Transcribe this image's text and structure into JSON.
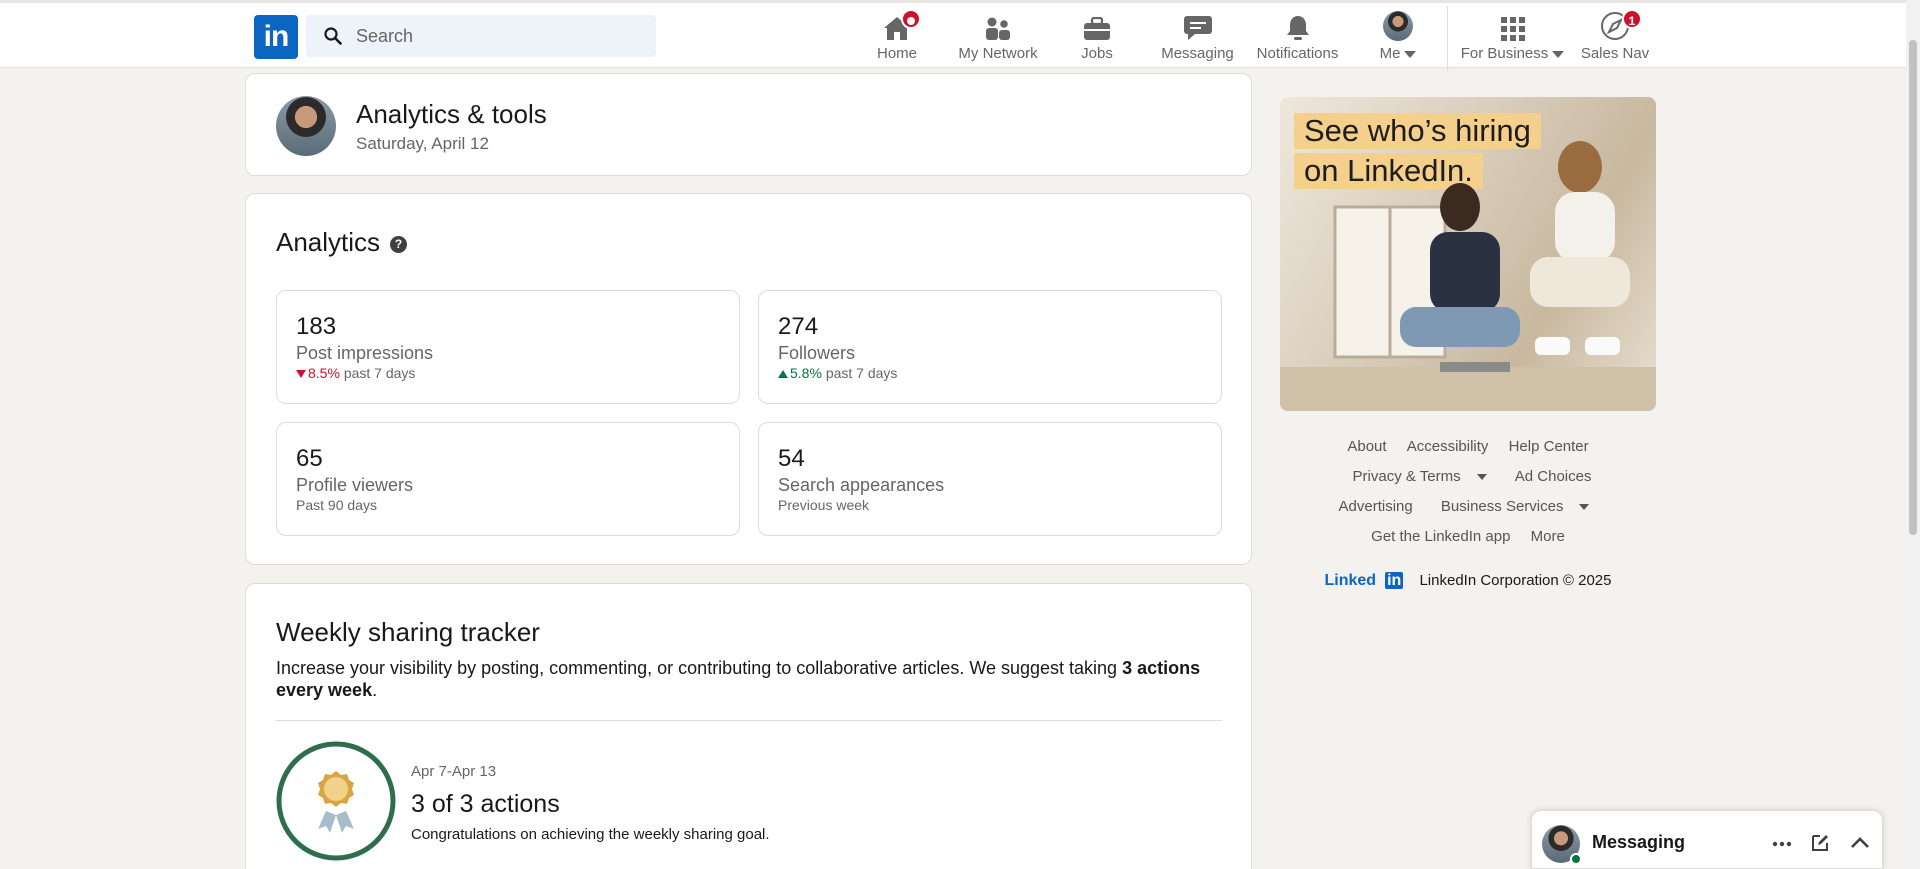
{
  "nav": {
    "search_placeholder": "Search",
    "items": [
      {
        "label": "Home"
      },
      {
        "label": "My Network"
      },
      {
        "label": "Jobs"
      },
      {
        "label": "Messaging"
      },
      {
        "label": "Notifications"
      },
      {
        "label": "Me"
      },
      {
        "label": "For Business"
      },
      {
        "label": "Sales Nav",
        "badge": "1"
      }
    ]
  },
  "header_card": {
    "title": "Analytics & tools",
    "date": "Saturday, April 12"
  },
  "analytics": {
    "title": "Analytics",
    "stats": [
      {
        "value": "183",
        "label": "Post impressions",
        "change": "8.5%",
        "direction": "down",
        "period": "past 7 days"
      },
      {
        "value": "274",
        "label": "Followers",
        "change": "5.8%",
        "direction": "up",
        "period": "past 7 days"
      },
      {
        "value": "65",
        "label": "Profile viewers",
        "period": "Past 90 days"
      },
      {
        "value": "54",
        "label": "Search appearances",
        "period": "Previous week"
      }
    ]
  },
  "tracker": {
    "title": "Weekly sharing tracker",
    "desc_prefix": "Increase your visibility by posting, commenting, or contributing to collaborative articles. We suggest taking ",
    "desc_bold": "3 actions every week",
    "desc_suffix": ".",
    "range": "Apr 7-Apr 13",
    "progress": "3 of 3 actions",
    "progress_fraction": 1.0,
    "congrats": "Congratulations on achieving the weekly sharing goal."
  },
  "ad": {
    "line1": "See who’s hiring",
    "line2": "on LinkedIn."
  },
  "footer": {
    "rows": [
      [
        "About",
        "Accessibility",
        "Help Center"
      ],
      [
        "Privacy & Terms",
        "Ad Choices"
      ],
      [
        "Advertising",
        "Business Services"
      ],
      [
        "Get the LinkedIn app",
        "More"
      ]
    ],
    "brand": "Linked",
    "brand_in": "in",
    "copyright": "LinkedIn Corporation © 2025"
  },
  "messaging": {
    "label": "Messaging"
  },
  "colors": {
    "brand": "#0a66c2",
    "negative": "#cb112d",
    "positive": "#057642",
    "badge_ring": "#2e6e4b"
  }
}
